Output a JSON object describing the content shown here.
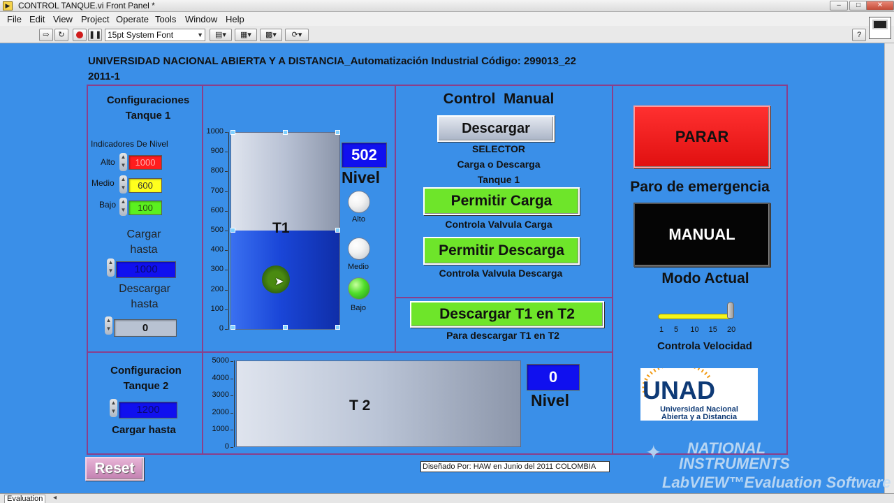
{
  "window": {
    "title": "CONTROL TANQUE.vi Front Panel *",
    "min_label": "–",
    "max_label": "□",
    "close_label": "✕"
  },
  "menu": [
    "File",
    "Edit",
    "View",
    "Project",
    "Operate",
    "Tools",
    "Window",
    "Help"
  ],
  "toolbar": {
    "font": "15pt System Font",
    "help_label": "?"
  },
  "header": {
    "line1": "UNIVERSIDAD NACIONAL ABIERTA Y A DISTANCIA_Automatización Industrial Código: 299013_22",
    "line2": "2011-1"
  },
  "config_t1": {
    "title_line1": "Configuraciones",
    "title_line2": "Tanque 1",
    "indicators_title": "Indicadores De Nivel",
    "alto_label": "Alto",
    "alto_value": "1000",
    "medio_label": "Medio",
    "medio_value": "600",
    "bajo_label": "Bajo",
    "bajo_value": "100",
    "cargar_line1": "Cargar",
    "cargar_line2": "hasta",
    "cargar_value": "1000",
    "descargar_line1": "Descargar",
    "descargar_line2": "hasta",
    "descargar_value": "0"
  },
  "tank1": {
    "name": "T1",
    "level": 502,
    "max": 1000,
    "scale": [
      "1000",
      "900",
      "800",
      "700",
      "600",
      "500",
      "400",
      "300",
      "200",
      "100",
      "0"
    ],
    "level_display": "502",
    "level_label": "Nivel",
    "led_alto": "Alto",
    "led_medio": "Medio",
    "led_bajo": "Bajo"
  },
  "control_manual": {
    "title": "Control  Manual",
    "descargar_button": "Descargar",
    "selector_line1": "SELECTOR",
    "selector_line2": "Carga o Descarga",
    "selector_line3": "Tanque 1",
    "permitir_carga": "Permitir Carga",
    "valvula_carga": "Controla Valvula Carga",
    "permitir_descarga": "Permitir Descarga",
    "valvula_descarga": "Controla Valvula Descarga"
  },
  "transfer": {
    "button": "Descargar T1 en T2",
    "caption": "Para descargar T1 en T2"
  },
  "emergency": {
    "stop_button": "PARAR",
    "stop_caption": "Paro de emergencia",
    "mode_button": "MANUAL",
    "mode_caption": "Modo Actual",
    "slider_value": 20,
    "slider_min": 1,
    "slider_max": 20,
    "slider_ticks": [
      "1",
      "5",
      "10",
      "15",
      "20"
    ],
    "slider_caption": "Controla Velocidad"
  },
  "logo": {
    "wordmark": "UNAD",
    "line1": "Universidad Nacional",
    "line2": "Abierta y a Distancia"
  },
  "config_t2": {
    "title_line1": "Configuracion",
    "title_line2": "Tanque 2",
    "cargar_value": "1200",
    "cargar_label": "Cargar hasta"
  },
  "tank2": {
    "name": "T 2",
    "level": 0,
    "max": 5000,
    "scale": [
      "5000",
      "4000",
      "3000",
      "2000",
      "1000",
      "0"
    ],
    "level_display": "0",
    "level_label": "Nivel"
  },
  "reset_button": "Reset",
  "credit": "Diseñado Por: HAW en Junio del  2011  COLOMBIA",
  "watermark": {
    "line1": "NATIONAL",
    "line2": "INSTRUMENTS",
    "line3": "LabVIEW™Evaluation Software"
  },
  "statusbar": {
    "label": "Evaluation",
    "arrow": "◂"
  },
  "colors": {
    "panel": "#3a8fe8",
    "frame": "#8a3f8a",
    "green_button": "#6ee52a",
    "red_button": "#ff1a1a",
    "fluid": "#1a46d8",
    "alto": "#ff1d1d",
    "medio": "#ffff1d",
    "bajo": "#5bf01f"
  }
}
